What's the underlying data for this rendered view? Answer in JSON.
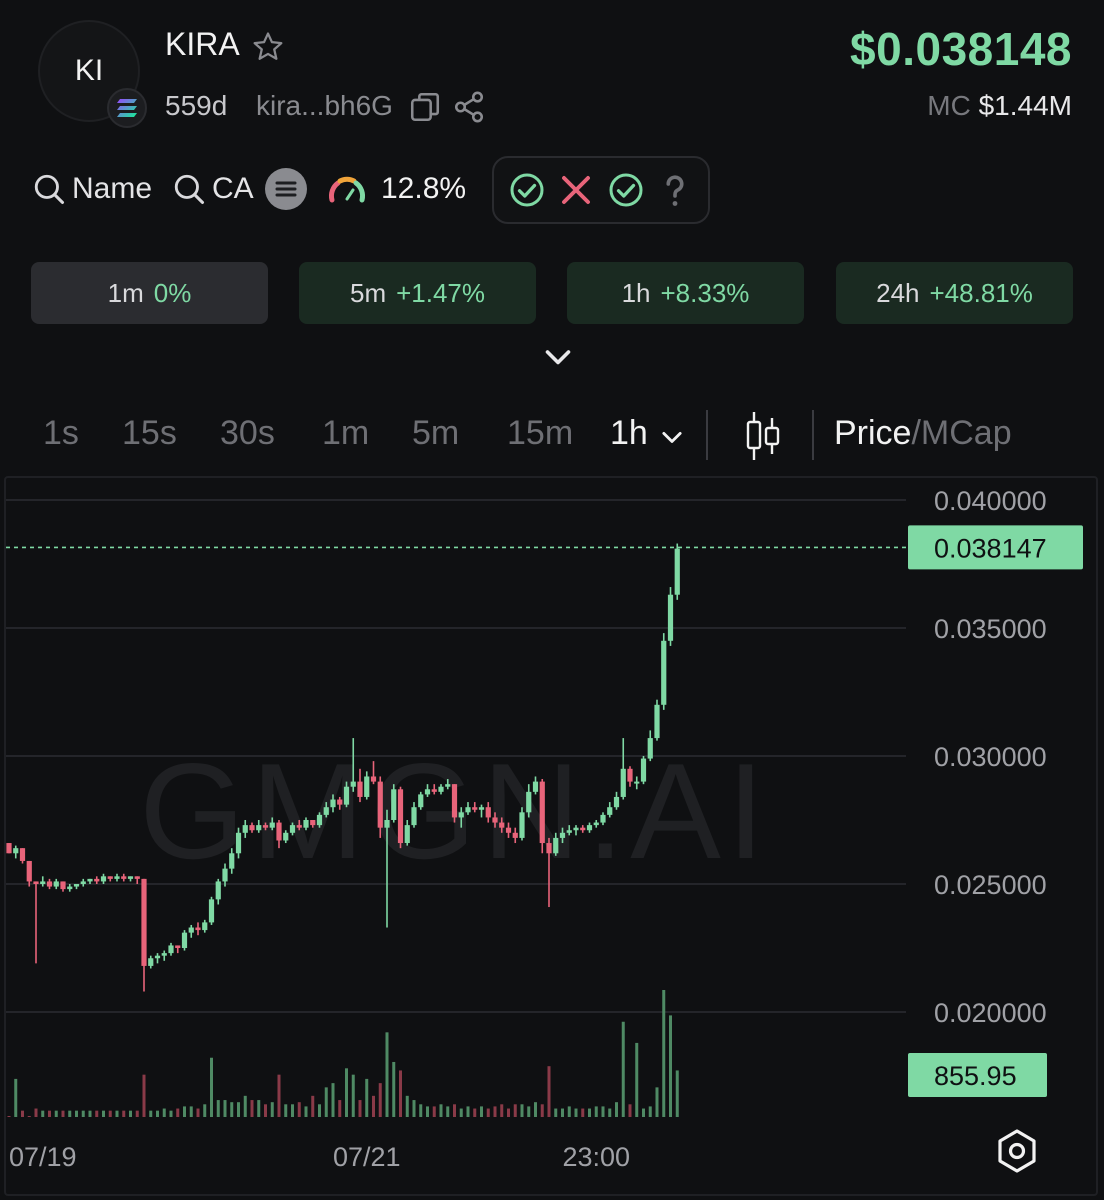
{
  "token": {
    "avatar_text": "KI",
    "name": "KIRA",
    "age": "559d",
    "address": "kira...bh6G",
    "price": "$0.038148",
    "mc_label": "MC",
    "mc_value": "$1.44M"
  },
  "toolbar": {
    "search_name": "Name",
    "search_ca": "CA",
    "risk_value": "12.8%"
  },
  "stats": [
    {
      "tf": "1m",
      "pct": "0%"
    },
    {
      "tf": "5m",
      "pct": "+1.47%"
    },
    {
      "tf": "1h",
      "pct": "+8.33%"
    },
    {
      "tf": "24h",
      "pct": "+48.81%"
    }
  ],
  "timeframes": [
    "1s",
    "15s",
    "30s",
    "1m",
    "5m",
    "15m",
    "1h"
  ],
  "mode": {
    "price": "Price",
    "sep": "/",
    "mcap": "MCap"
  },
  "colors": {
    "up": "#7fd9a4",
    "down": "#e8647a",
    "vol_up": "#4f8a64",
    "vol_down": "#8a3a48"
  },
  "chart_data": {
    "type": "candlestick",
    "watermark": "GMGN.AI",
    "y_ticks": [
      "0.040000",
      "0.035000",
      "0.030000",
      "0.025000",
      "0.020000"
    ],
    "y_tick_values": [
      0.04,
      0.035,
      0.03,
      0.025,
      0.02
    ],
    "ylim": [
      0.0175,
      0.0415
    ],
    "last_price_label": "0.038147",
    "last_price": 0.038147,
    "volume_label": "855.95",
    "x_ticks": [
      {
        "label": "07/19",
        "index": 5
      },
      {
        "label": "07/21",
        "index": 53
      },
      {
        "label": "23:00",
        "index": 87
      }
    ],
    "candle_count": 100,
    "candles": [
      [
        0.0266,
        0.0266,
        0.0262,
        0.0262
      ],
      [
        0.0262,
        0.0265,
        0.026,
        0.0264
      ],
      [
        0.0264,
        0.0264,
        0.0258,
        0.0259
      ],
      [
        0.0259,
        0.0259,
        0.0249,
        0.0251
      ],
      [
        0.0251,
        0.0251,
        0.0219,
        0.025
      ],
      [
        0.025,
        0.0253,
        0.0249,
        0.0251
      ],
      [
        0.0251,
        0.0252,
        0.0248,
        0.0249
      ],
      [
        0.0249,
        0.0252,
        0.0248,
        0.0251
      ],
      [
        0.0251,
        0.0251,
        0.0247,
        0.0248
      ],
      [
        0.0248,
        0.025,
        0.0247,
        0.0249
      ],
      [
        0.0249,
        0.025,
        0.0248,
        0.025
      ],
      [
        0.025,
        0.0252,
        0.0249,
        0.0251
      ],
      [
        0.0251,
        0.0252,
        0.025,
        0.0252
      ],
      [
        0.0252,
        0.0253,
        0.025,
        0.0251
      ],
      [
        0.0251,
        0.0254,
        0.025,
        0.0253
      ],
      [
        0.0253,
        0.0253,
        0.0251,
        0.0252
      ],
      [
        0.0252,
        0.0254,
        0.0251,
        0.0253
      ],
      [
        0.0253,
        0.0254,
        0.0251,
        0.0252
      ],
      [
        0.0252,
        0.0253,
        0.0251,
        0.0253
      ],
      [
        0.0253,
        0.0253,
        0.025,
        0.0252
      ],
      [
        0.0252,
        0.0252,
        0.0208,
        0.0218
      ],
      [
        0.0218,
        0.0222,
        0.0217,
        0.0221
      ],
      [
        0.0221,
        0.0223,
        0.0219,
        0.0222
      ],
      [
        0.0222,
        0.0224,
        0.022,
        0.0223
      ],
      [
        0.0223,
        0.0227,
        0.0222,
        0.0226
      ],
      [
        0.0226,
        0.0226,
        0.0223,
        0.0225
      ],
      [
        0.0225,
        0.0232,
        0.0224,
        0.0231
      ],
      [
        0.0231,
        0.0234,
        0.0229,
        0.0233
      ],
      [
        0.0233,
        0.0235,
        0.023,
        0.0232
      ],
      [
        0.0232,
        0.0236,
        0.0231,
        0.0235
      ],
      [
        0.0235,
        0.0245,
        0.0234,
        0.0244
      ],
      [
        0.0244,
        0.0252,
        0.0242,
        0.0251
      ],
      [
        0.0251,
        0.0258,
        0.0249,
        0.0256
      ],
      [
        0.0256,
        0.0264,
        0.0254,
        0.0262
      ],
      [
        0.0262,
        0.0272,
        0.026,
        0.027
      ],
      [
        0.027,
        0.0275,
        0.0268,
        0.0273
      ],
      [
        0.0273,
        0.0274,
        0.027,
        0.0271
      ],
      [
        0.0271,
        0.0275,
        0.027,
        0.0273
      ],
      [
        0.0273,
        0.0274,
        0.0271,
        0.0272
      ],
      [
        0.0272,
        0.0276,
        0.0271,
        0.0274
      ],
      [
        0.0274,
        0.0275,
        0.0264,
        0.0267
      ],
      [
        0.0267,
        0.0271,
        0.0266,
        0.027
      ],
      [
        0.027,
        0.0274,
        0.0269,
        0.0273
      ],
      [
        0.0273,
        0.0275,
        0.0271,
        0.0272
      ],
      [
        0.0272,
        0.0276,
        0.0271,
        0.0275
      ],
      [
        0.0275,
        0.0275,
        0.0272,
        0.0273
      ],
      [
        0.0273,
        0.0278,
        0.0272,
        0.0277
      ],
      [
        0.0277,
        0.0282,
        0.0276,
        0.028
      ],
      [
        0.028,
        0.0285,
        0.0278,
        0.0283
      ],
      [
        0.0283,
        0.0284,
        0.0279,
        0.0281
      ],
      [
        0.0281,
        0.029,
        0.028,
        0.0288
      ],
      [
        0.0288,
        0.0307,
        0.0286,
        0.029
      ],
      [
        0.029,
        0.0295,
        0.0282,
        0.0284
      ],
      [
        0.0284,
        0.0294,
        0.0283,
        0.0292
      ],
      [
        0.0292,
        0.0298,
        0.0289,
        0.029
      ],
      [
        0.029,
        0.0292,
        0.0268,
        0.0272
      ],
      [
        0.0272,
        0.0279,
        0.0233,
        0.0275
      ],
      [
        0.0275,
        0.0289,
        0.0274,
        0.0287
      ],
      [
        0.0287,
        0.0288,
        0.0264,
        0.0266
      ],
      [
        0.0266,
        0.0275,
        0.0265,
        0.0273
      ],
      [
        0.0273,
        0.0282,
        0.0272,
        0.028
      ],
      [
        0.028,
        0.0286,
        0.0279,
        0.0285
      ],
      [
        0.0285,
        0.0289,
        0.0284,
        0.0287
      ],
      [
        0.0287,
        0.0289,
        0.0285,
        0.0286
      ],
      [
        0.0286,
        0.0289,
        0.0285,
        0.0288
      ],
      [
        0.0288,
        0.0291,
        0.0287,
        0.0289
      ],
      [
        0.0289,
        0.0289,
        0.0274,
        0.0276
      ],
      [
        0.0276,
        0.028,
        0.0272,
        0.0278
      ],
      [
        0.0278,
        0.0282,
        0.0277,
        0.028
      ],
      [
        0.028,
        0.0282,
        0.0278,
        0.0279
      ],
      [
        0.0279,
        0.0281,
        0.0276,
        0.028
      ],
      [
        0.028,
        0.0282,
        0.0274,
        0.0276
      ],
      [
        0.0276,
        0.0278,
        0.0272,
        0.0274
      ],
      [
        0.0274,
        0.0276,
        0.027,
        0.0272
      ],
      [
        0.0272,
        0.0274,
        0.0268,
        0.027
      ],
      [
        0.027,
        0.0272,
        0.0266,
        0.0268
      ],
      [
        0.0268,
        0.028,
        0.0267,
        0.0278
      ],
      [
        0.0278,
        0.0289,
        0.0276,
        0.0286
      ],
      [
        0.0286,
        0.0292,
        0.0285,
        0.029
      ],
      [
        0.029,
        0.0291,
        0.0262,
        0.0266
      ],
      [
        0.0266,
        0.0268,
        0.0241,
        0.0262
      ],
      [
        0.0262,
        0.027,
        0.0261,
        0.0268
      ],
      [
        0.0268,
        0.0272,
        0.0266,
        0.027
      ],
      [
        0.027,
        0.0273,
        0.0269,
        0.0271
      ],
      [
        0.0271,
        0.0273,
        0.0269,
        0.0272
      ],
      [
        0.0272,
        0.0273,
        0.027,
        0.0271
      ],
      [
        0.0271,
        0.0274,
        0.027,
        0.0273
      ],
      [
        0.0273,
        0.0275,
        0.0272,
        0.0274
      ],
      [
        0.0274,
        0.0278,
        0.0273,
        0.0277
      ],
      [
        0.0277,
        0.0282,
        0.0276,
        0.028
      ],
      [
        0.028,
        0.0286,
        0.0279,
        0.0284
      ],
      [
        0.0284,
        0.0307,
        0.0283,
        0.0295
      ],
      [
        0.0295,
        0.0296,
        0.0288,
        0.029
      ],
      [
        0.029,
        0.0292,
        0.0287,
        0.029
      ],
      [
        0.029,
        0.03,
        0.0289,
        0.0299
      ],
      [
        0.0299,
        0.031,
        0.0298,
        0.0307
      ],
      [
        0.0307,
        0.0322,
        0.0306,
        0.032
      ],
      [
        0.032,
        0.0348,
        0.0318,
        0.0345
      ],
      [
        0.0345,
        0.0366,
        0.0343,
        0.0363
      ],
      [
        0.0363,
        0.0383,
        0.0361,
        0.0381
      ]
    ],
    "volumes": [
      0.0,
      18,
      3,
      0.3,
      4,
      3,
      3,
      3,
      3,
      3,
      3,
      3,
      3,
      3,
      3,
      3,
      3,
      3,
      3,
      3,
      20,
      3,
      3,
      4,
      3,
      4,
      5,
      5,
      4,
      6,
      28,
      8,
      8,
      7,
      7,
      10,
      8,
      8,
      6,
      7,
      20,
      6,
      6,
      7,
      5,
      10,
      6,
      14,
      16,
      8,
      23,
      20,
      8,
      18,
      10,
      16,
      40,
      26,
      22,
      10,
      8,
      6,
      5,
      5,
      6,
      5,
      6,
      4,
      5,
      4,
      5,
      4,
      5,
      6,
      4,
      6,
      6,
      5,
      7,
      6,
      24,
      4,
      4,
      5,
      4,
      4,
      4,
      5,
      5,
      4,
      7,
      45,
      6,
      35,
      4,
      5,
      14,
      60,
      48,
      22
    ]
  }
}
